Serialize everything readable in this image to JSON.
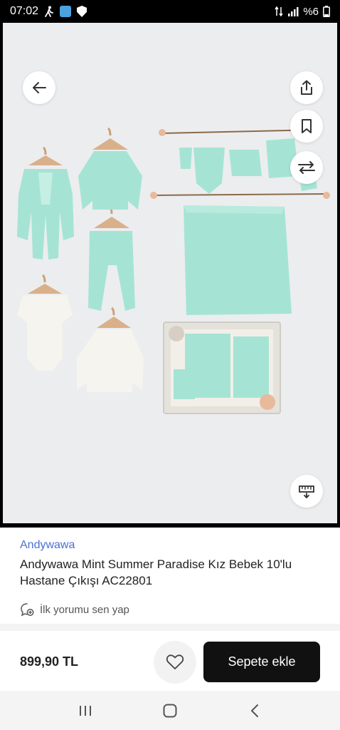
{
  "status_bar": {
    "time": "07:02",
    "battery": "%6",
    "icons": [
      "walking-icon",
      "app-notification-icon",
      "shield-icon",
      "data-signal-icon",
      "cell-signal-icon",
      "battery-icon"
    ]
  },
  "hero": {
    "image_alt": "Baby clothing set product photo",
    "buttons": [
      "back-arrow-icon",
      "share-icon",
      "bookmark-icon",
      "compare-arrows-icon",
      "ruler-icon"
    ]
  },
  "product": {
    "brand": "Andywawa",
    "title": "Andywawa Mint Summer Paradise Kız Bebek 10'lu Hastane Çıkışı AC22801",
    "review_prompt": "İlk yorumu sen yap"
  },
  "actions": {
    "price": "899,90 TL",
    "add_to_cart": "Sepete ekle"
  },
  "navbar": {
    "items": [
      "recent-apps-icon",
      "home-icon",
      "back-icon"
    ]
  },
  "colors": {
    "brand_link": "#4b6fd6",
    "cart_button": "#111111",
    "mint": "#9fe3d2"
  }
}
